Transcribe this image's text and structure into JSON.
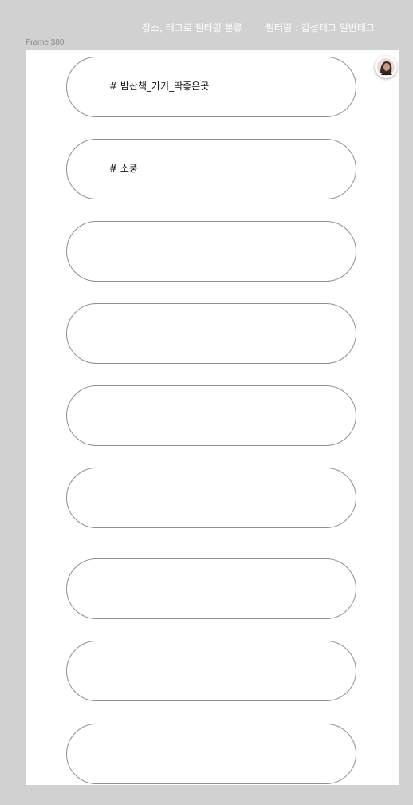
{
  "annotations": {
    "left": "장소, 태그로 필터링 분류",
    "right": "필터링 : 감성태그 일반태그"
  },
  "frame": {
    "label": "Frame 380"
  },
  "tags": [
    {
      "label": "# 밤산책_가기_딱좋은곳"
    },
    {
      "label": "# 소풍"
    },
    {
      "label": ""
    },
    {
      "label": ""
    },
    {
      "label": ""
    },
    {
      "label": ""
    },
    {
      "label": ""
    },
    {
      "label": ""
    },
    {
      "label": ""
    }
  ],
  "colors": {
    "canvas": "#d1d1d1",
    "frame": "#ffffff",
    "pill_border": "#8f8f8f"
  },
  "icons": {
    "avatar": "user-avatar-icon"
  }
}
